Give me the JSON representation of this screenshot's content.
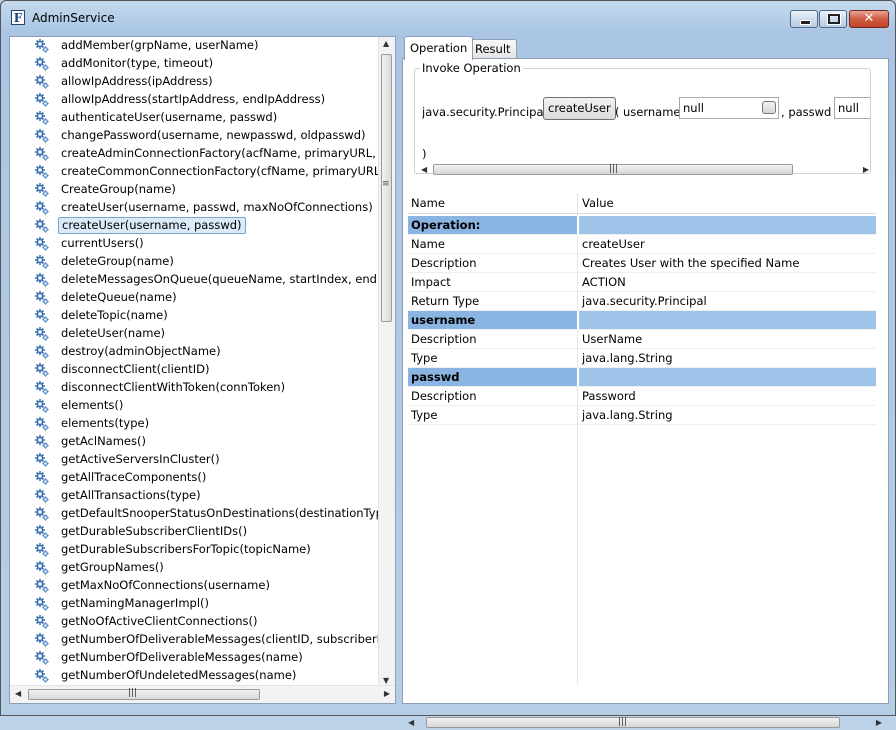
{
  "window": {
    "title": "AdminService",
    "app_icon_letter": "F"
  },
  "methods": [
    "addMember(grpName, userName)",
    "addMonitor(type, timeout)",
    "allowIpAddress(ipAddress)",
    "allowIpAddress(startIpAddress, endIpAddress)",
    "authenticateUser(username, passwd)",
    "changePassword(username, newpasswd, oldpasswd)",
    "createAdminConnectionFactory(acfName, primaryURL, backu",
    "createCommonConnectionFactory(cfName, primaryURL, bac",
    "CreateGroup(name)",
    "createUser(username, passwd, maxNoOfConnections)",
    "createUser(username, passwd)",
    "currentUsers()",
    "deleteGroup(name)",
    "deleteMessagesOnQueue(queueName, startIndex, endIndex, p",
    "deleteQueue(name)",
    "deleteTopic(name)",
    "deleteUser(name)",
    "destroy(adminObjectName)",
    "disconnectClient(clientID)",
    "disconnectClientWithToken(connToken)",
    "elements()",
    "elements(type)",
    "getAclNames()",
    "getActiveServersInCluster()",
    "getAllTraceComponents()",
    "getAllTransactions(type)",
    "getDefaultSnooperStatusOnDestinations(destinationType)",
    "getDurableSubscriberClientIDs()",
    "getDurableSubscribersForTopic(topicName)",
    "getGroupNames()",
    "getMaxNoOfConnections(username)",
    "getNamingManagerImpl()",
    "getNoOfActiveClientConnections()",
    "getNumberOfDeliverableMessages(clientID, subscriberID)",
    "getNumberOfDeliverableMessages(name)",
    "getNumberOfUndeletedMessages(name)"
  ],
  "selected_method_index": 10,
  "tabs": {
    "operation": "Operation",
    "result": "Result"
  },
  "invoke": {
    "legend": "Invoke Operation",
    "return_type": "java.security.Principal",
    "button_label": "createUser",
    "open_paren": "(",
    "param1_name": "username",
    "param1_value": "null",
    "separator": ",",
    "param2_name": "passwd",
    "param2_value": "null",
    "close_brace": ")"
  },
  "properties": {
    "header": {
      "name": "Name",
      "value": "Value"
    },
    "rows": [
      {
        "kind": "section",
        "name": "Operation:",
        "value": ""
      },
      {
        "kind": "row",
        "name": "Name",
        "value": "createUser"
      },
      {
        "kind": "row",
        "name": "Description",
        "value": "Creates User with the specified Name"
      },
      {
        "kind": "row",
        "name": "Impact",
        "value": "ACTION"
      },
      {
        "kind": "row",
        "name": "Return Type",
        "value": "java.security.Principal"
      },
      {
        "kind": "section",
        "name": "username",
        "value": ""
      },
      {
        "kind": "row",
        "name": "Description",
        "value": "UserName"
      },
      {
        "kind": "row",
        "name": "Type",
        "value": "java.lang.String"
      },
      {
        "kind": "section",
        "name": "passwd",
        "value": ""
      },
      {
        "kind": "row",
        "name": "Description",
        "value": "Password"
      },
      {
        "kind": "row",
        "name": "Type",
        "value": "java.lang.String"
      }
    ]
  },
  "icons": {
    "method": "gear-icon",
    "minimize": "minimize-icon",
    "maximize": "maximize-icon",
    "close": "close-icon",
    "browse": "browse-icon"
  },
  "colors": {
    "section_row": "#8ab4e1",
    "selection": "#dbeaf9",
    "window_frame": "#b6cde6"
  }
}
